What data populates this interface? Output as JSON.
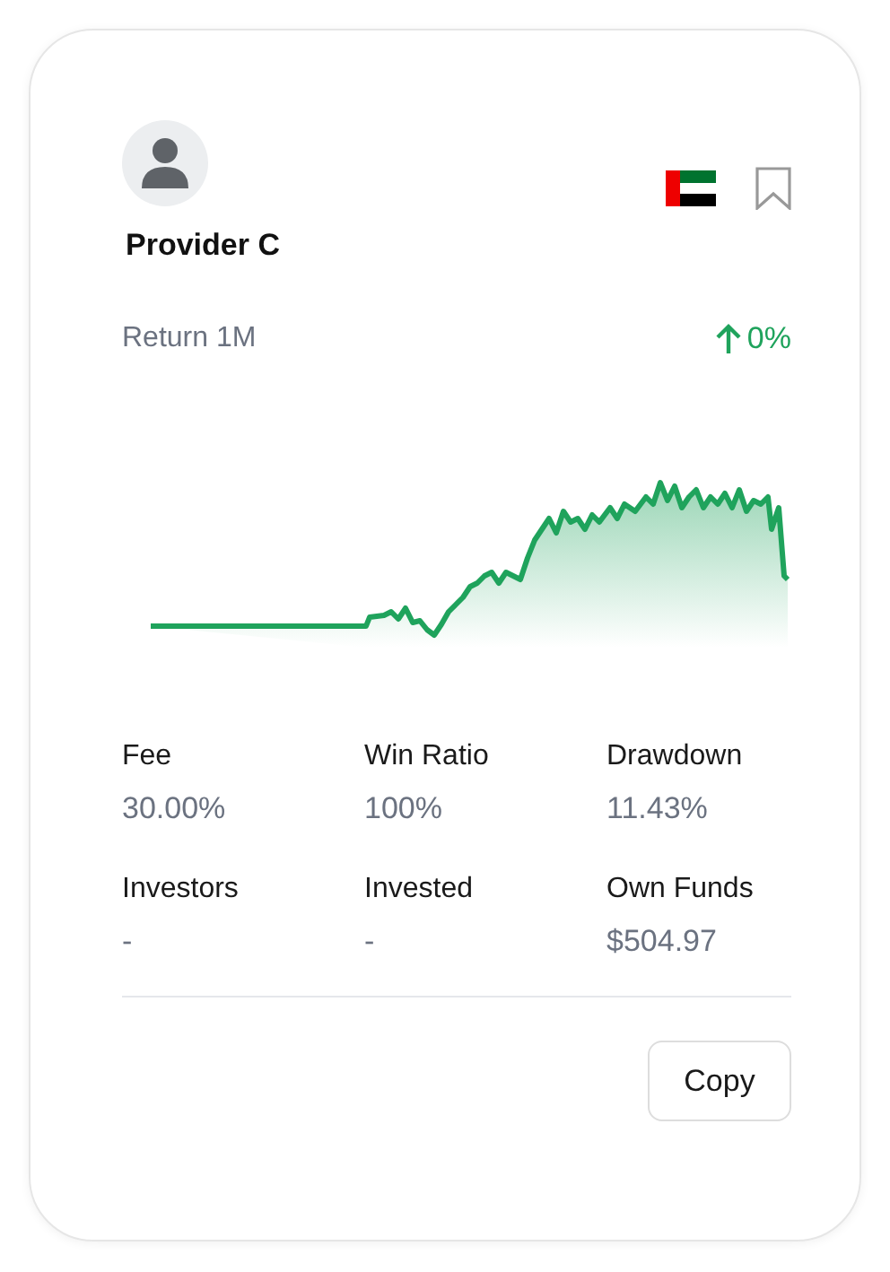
{
  "provider": {
    "name": "Provider C",
    "bookmarked": false
  },
  "return": {
    "label": "Return 1M",
    "value": "0%",
    "rising": true
  },
  "stats": [
    {
      "label": "Fee",
      "value": "30.00%"
    },
    {
      "label": "Win Ratio",
      "value": "100%"
    },
    {
      "label": "Drawdown",
      "value": "11.43%"
    },
    {
      "label": "Investors",
      "value": "-"
    },
    {
      "label": "Invested",
      "value": "-"
    },
    {
      "label": "Own Funds",
      "value": "$504.97"
    }
  ],
  "button": "Copy"
}
